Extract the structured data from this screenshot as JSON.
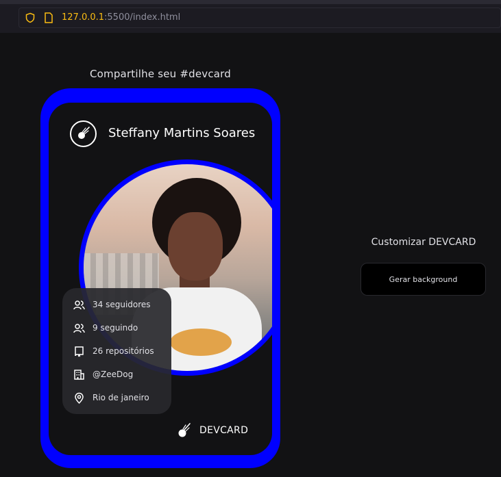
{
  "browser": {
    "url_host": "127.0.0.1",
    "url_rest": ":5500/index.html"
  },
  "share": {
    "title": "Compartilhe seu #devcard"
  },
  "card": {
    "name": "Steffany Martins Soares",
    "brand": "DEVCARD",
    "stats": [
      {
        "icon": "followers-icon",
        "label": "34 seguidores"
      },
      {
        "icon": "following-icon",
        "label": "9 seguindo"
      },
      {
        "icon": "repository-icon",
        "label": "26 repositórios"
      },
      {
        "icon": "company-icon",
        "label": "@ZeeDog"
      },
      {
        "icon": "location-icon",
        "label": "Rio de janeiro"
      }
    ]
  },
  "customize": {
    "title": "Customizar DEVCARD",
    "generate_button": "Gerar background"
  },
  "colors": {
    "background": "#121214",
    "card_accent": "#0000ff",
    "url_host": "#fbbd12"
  }
}
